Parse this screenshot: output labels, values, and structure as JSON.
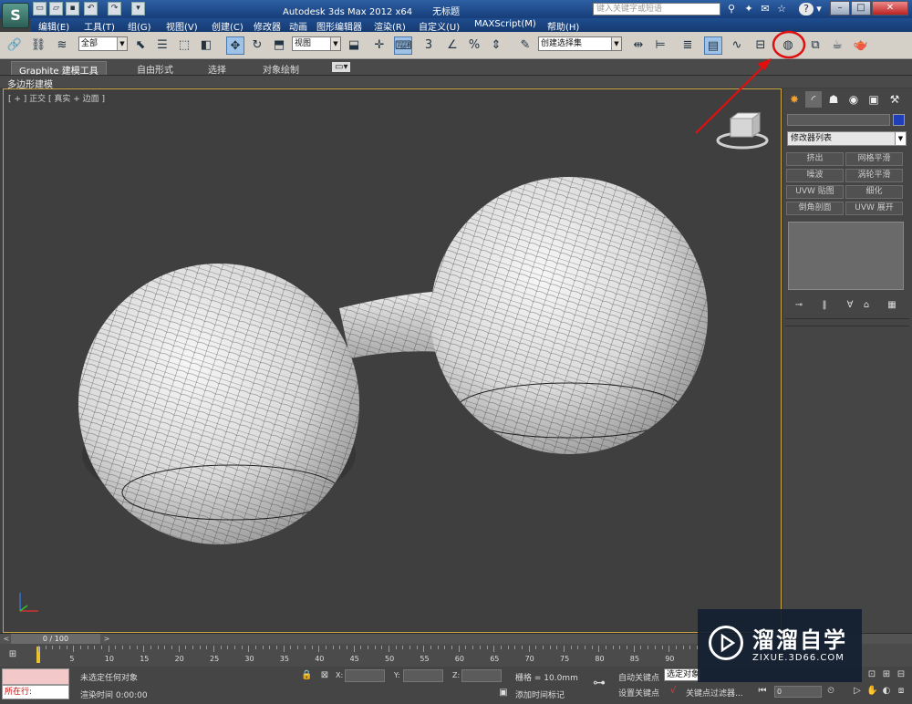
{
  "window": {
    "app_title": "Autodesk 3ds Max  2012 x64",
    "doc_title": "无标题",
    "search_placeholder": "键入关键字或短语",
    "logo": "S",
    "min": "–",
    "max": "□",
    "close": "✕"
  },
  "menus": [
    "编辑(E)",
    "工具(T)",
    "组(G)",
    "视图(V)",
    "创建(C)",
    "修改器",
    "动画",
    "图形编辑器",
    "渲染(R)",
    "自定义(U)",
    "MAXScript(M)",
    "帮助(H)"
  ],
  "toolbar": {
    "selection_filter": "全部",
    "ref_coord": "视图",
    "named_selection": "创建选择集",
    "snap_number": "3",
    "percent": "%"
  },
  "ribbon": {
    "tabs": [
      "Graphite 建模工具",
      "自由形式",
      "选择",
      "对象绘制"
    ],
    "active_tab": "Graphite 建模工具",
    "sub_label": "多边形建模"
  },
  "viewport": {
    "label": "[ + ] 正交 [ 真实 + 边面 ]"
  },
  "command_panel": {
    "modifier_list": "修改器列表",
    "buttons": [
      "挤出",
      "网格平滑",
      "噪波",
      "涡轮平滑",
      "UVW 贴图",
      "细化",
      "倒角剖面",
      "UVW 展开"
    ]
  },
  "timeline": {
    "frame_display": "0 / 100",
    "ticks": [
      "5",
      "10",
      "15",
      "20",
      "25",
      "30",
      "35",
      "40",
      "45",
      "50",
      "55",
      "60",
      "65",
      "70",
      "75",
      "80",
      "85",
      "90"
    ]
  },
  "status": {
    "maxscript_label": "所在行:",
    "selection": "未选定任何对象",
    "render_time": "渲染时间  0:00:00",
    "x_label": "X:",
    "y_label": "Y:",
    "z_label": "Z:",
    "grid": "栅格 = 10.0mm",
    "add_time_tag": "添加时间标记",
    "auto_key": "自动关键点",
    "selected_object": "选定对象",
    "set_key": "设置关键点",
    "key_filters": "关键点过滤器...",
    "frame_value": "0"
  },
  "watermark": {
    "title": "溜溜自学",
    "url": "ZIXUE.3D66.COM"
  },
  "colors": {
    "viewport_bg": "#3f3f3f",
    "highlight_red": "#e01010",
    "viewport_border": "#c8a646"
  }
}
